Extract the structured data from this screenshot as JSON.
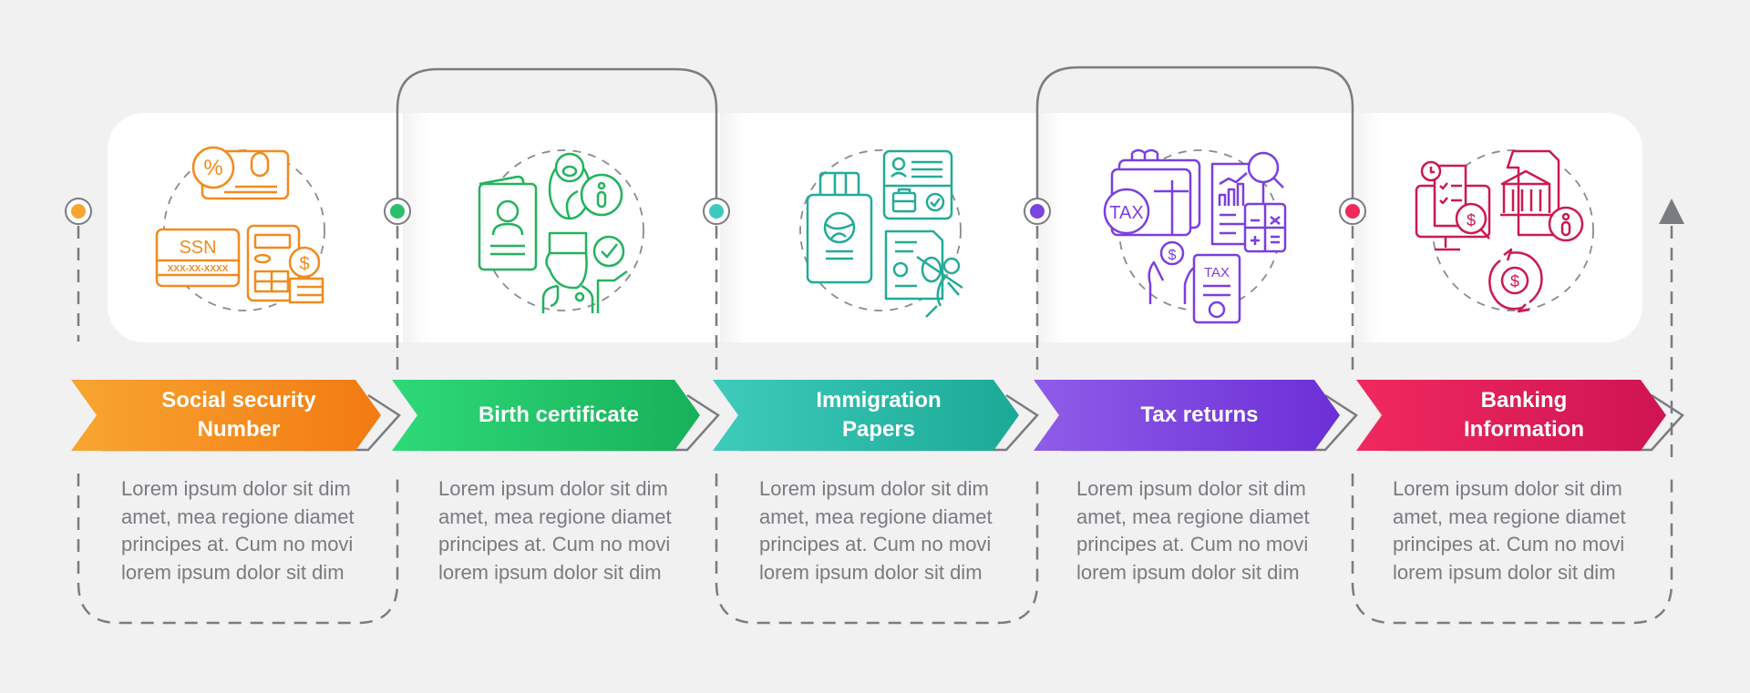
{
  "steps": [
    {
      "title": "Social security\nNumber",
      "icon": "ssn-card-icon",
      "color_start": "#f8a531",
      "color_end": "#f27a12",
      "node_color": "#f7a531",
      "description": "Lorem ipsum dolor sit dim amet, mea regione diamet principes at. Cum no movi lorem ipsum dolor sit dim"
    },
    {
      "title": "Birth certificate",
      "icon": "birth-certificate-icon",
      "color_start": "#2ed978",
      "color_end": "#17b15a",
      "node_color": "#2bbf6b",
      "description": "Lorem ipsum dolor sit dim amet, mea regione diamet principes at. Cum no movi lorem ipsum dolor sit dim"
    },
    {
      "title": "Immigration\nPapers",
      "icon": "immigration-papers-icon",
      "color_start": "#3ecbbb",
      "color_end": "#1baa96",
      "node_color": "#3ccabd",
      "description": "Lorem ipsum dolor sit dim amet, mea regione diamet principes at. Cum no movi lorem ipsum dolor sit dim"
    },
    {
      "title": "Tax returns",
      "icon": "tax-returns-icon",
      "color_start": "#8f5ce8",
      "color_end": "#6b2fd6",
      "node_color": "#7a45de",
      "description": "Lorem ipsum dolor sit dim amet, mea regione diamet principes at. Cum no movi lorem ipsum dolor sit dim"
    },
    {
      "title": "Banking\nInformation",
      "icon": "banking-information-icon",
      "color_start": "#f0295f",
      "color_end": "#cf1452",
      "node_color": "#ee2a5a",
      "description": "Lorem ipsum dolor sit dim amet, mea regione diamet principes at. Cum no movi lorem ipsum dolor sit dim"
    }
  ],
  "icon_text": {
    "ssn": "SSN",
    "ssn_mask": "XXX-XX-XXXX",
    "tax": "TAX",
    "percent": "%",
    "dollar": "$"
  },
  "colors": {
    "background": "#f1f1f2",
    "connector": "#7b7b82",
    "description_text": "#7a7a80"
  }
}
